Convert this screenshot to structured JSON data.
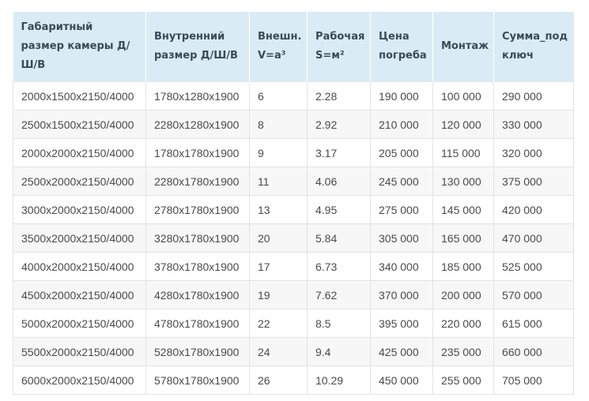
{
  "table": {
    "headers": [
      "Габаритный размер камеры Д/Ш/В",
      "Внутренний размер Д/Ш/В",
      "Внешн. V=а³",
      "Рабочая S=м²",
      "Цена погреба",
      "Монтаж",
      "Сумма_под ключ"
    ],
    "rows": [
      [
        "2000x1500x2150/4000",
        "1780x1280x1900",
        "6",
        "2.28",
        "190 000",
        "100 000",
        "290 000"
      ],
      [
        "2500x1500x2150/4000",
        "2280x1280x1900",
        "8",
        "2.92",
        "210 000",
        "120 000",
        "330 000"
      ],
      [
        "2000x2000x2150/4000",
        "1780x1780x1900",
        "9",
        "3.17",
        "205 000",
        "115 000",
        "320 000"
      ],
      [
        "2500x2000x2150/4000",
        "2280x1780x1900",
        "11",
        "4.06",
        "245 000",
        "130 000",
        "375 000"
      ],
      [
        "3000x2000x2150/4000",
        "2780x1780x1900",
        "13",
        "4.95",
        "275 000",
        "145 000",
        "420 000"
      ],
      [
        "3500x2000x2150/4000",
        "3280x1780x1900",
        "20",
        "5.84",
        "305 000",
        "165 000",
        "470 000"
      ],
      [
        "4000x2000x2150/4000",
        "3780x1780x1900",
        "17",
        "6.73",
        "340 000",
        "185 000",
        "525 000"
      ],
      [
        "4500x2000x2150/4000",
        "4280x1780x1900",
        "19",
        "7.62",
        "370 000",
        "200 000",
        "570 000"
      ],
      [
        "5000x2000x2150/4000",
        "4780x1780x1900",
        "22",
        "8.5",
        "395 000",
        "220 000",
        "615 000"
      ],
      [
        "5500x2000x2150/4000",
        "5280x1780x1900",
        "24",
        "9.4",
        "425 000",
        "235 000",
        "660 000"
      ],
      [
        "6000x2000x2150/4000",
        "5780x1780x1900",
        "26",
        "10.29",
        "450 000",
        "255 000",
        "705 000"
      ]
    ]
  }
}
